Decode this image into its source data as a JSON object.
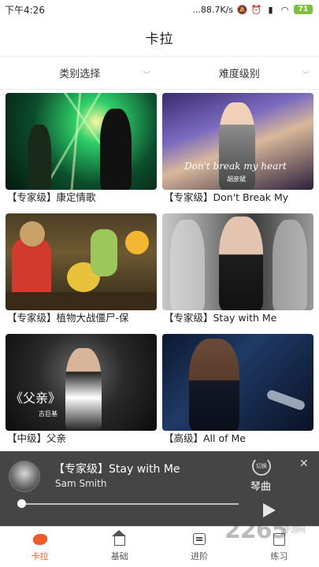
{
  "status_bar": {
    "time": "下午4:26",
    "network_speed": "...88.7K/s",
    "battery_level": "71"
  },
  "header": {
    "title": "卡拉"
  },
  "filters": [
    {
      "label": "类别选择"
    },
    {
      "label": "难度级别"
    }
  ],
  "cards": [
    {
      "caption": "【专家级】康定情歌",
      "overlay": ""
    },
    {
      "caption": "【专家级】Don't Break My",
      "overlay": "Don't break my heart",
      "overlay_sub": "胡彦斌"
    },
    {
      "caption": "【专家级】植物大战僵尸-保",
      "overlay": ""
    },
    {
      "caption": "【专家级】Stay with Me",
      "overlay": ""
    },
    {
      "caption": "【中级】父亲",
      "overlay": "《父亲》",
      "overlay_sub": "古巨基"
    },
    {
      "caption": "【高级】All of Me",
      "overlay": ""
    }
  ],
  "player": {
    "song": "【专家级】Stay with Me",
    "artist": "Sam Smith",
    "switch_label": "切换",
    "instrument": "琴曲",
    "progress": 0.0
  },
  "bottom_nav": [
    {
      "label": "卡拉",
      "icon": "karaoke-icon",
      "active": true
    },
    {
      "label": "基础",
      "icon": "home-icon",
      "active": false
    },
    {
      "label": "进阶",
      "icon": "list-icon",
      "active": false
    },
    {
      "label": "练习",
      "icon": "document-icon",
      "active": false
    }
  ],
  "watermark": {
    "text": "2265",
    "sub": "手游网"
  },
  "colors": {
    "accent": "#f05a28",
    "player_bg": "#454545"
  }
}
